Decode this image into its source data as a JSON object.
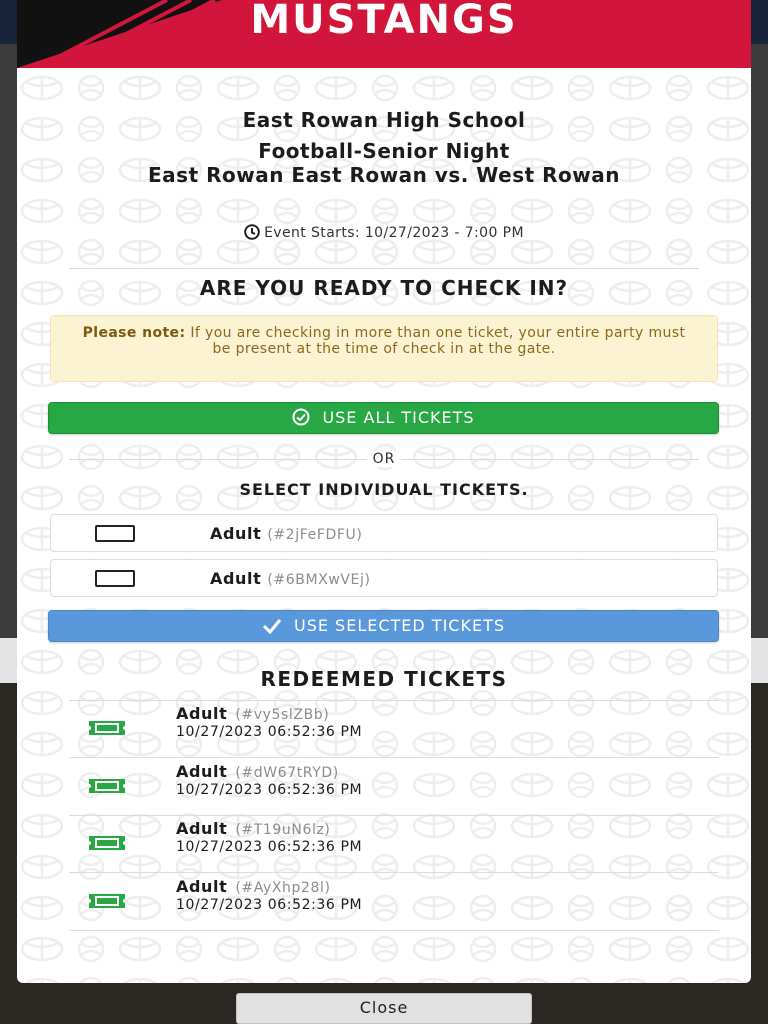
{
  "banner": {
    "title": "MUSTANGS"
  },
  "event": {
    "school": "East Rowan High School",
    "name": "Football-Senior Night",
    "matchup": "East Rowan East Rowan vs. West Rowan",
    "starts": "Event Starts: 10/27/2023 - 7:00 PM"
  },
  "checkin": {
    "heading": "ARE YOU READY TO CHECK IN?",
    "note_label": "Please note:",
    "note_text": " If you are checking in more than one ticket, your entire party must be present at the time of check in at the gate.",
    "use_all_label": "USE ALL TICKETS",
    "or_label": "OR",
    "select_heading": "SELECT INDIVIDUAL TICKETS.",
    "tickets": [
      {
        "type": "Adult",
        "code": "(#2jFeFDFU)",
        "checked": false
      },
      {
        "type": "Adult",
        "code": "(#6BMXwVEj)",
        "checked": false
      }
    ],
    "use_selected_label": "USE SELECTED TICKETS"
  },
  "redeemed": {
    "heading": "REDEEMED TICKETS",
    "items": [
      {
        "type": "Adult",
        "code": "(#vy5slZBb)",
        "time": "10/27/2023 06:52:36 PM"
      },
      {
        "type": "Adult",
        "code": "(#dW67tRYD)",
        "time": "10/27/2023 06:52:36 PM"
      },
      {
        "type": "Adult",
        "code": "(#T19uN6lz)",
        "time": "10/27/2023 06:52:36 PM"
      },
      {
        "type": "Adult",
        "code": "(#AyXhp28l)",
        "time": "10/27/2023 06:52:36 PM"
      }
    ]
  },
  "footer": {
    "close_label": "Close"
  },
  "colors": {
    "banner": "#d2153a",
    "green_button": "#28a745",
    "blue_button": "#5a98dc",
    "note_bg": "#fcf3d3",
    "ticket_icon": "#28a745"
  },
  "icons": {
    "clock": "clock-icon",
    "check_circle": "check-circle-icon",
    "checkmark": "checkmark-icon",
    "ticket": "ticket-icon"
  }
}
